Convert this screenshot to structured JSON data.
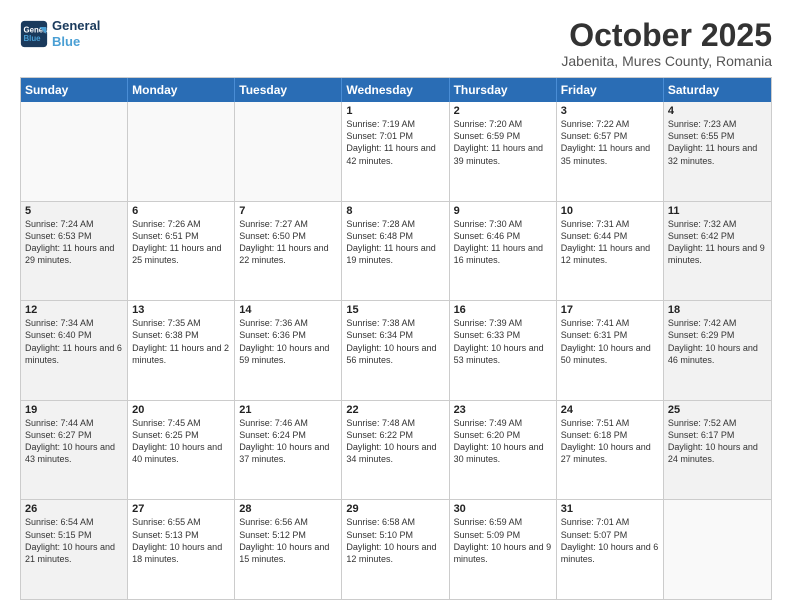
{
  "header": {
    "logo_line1": "General",
    "logo_line2": "Blue",
    "title": "October 2025",
    "subtitle": "Jabenita, Mures County, Romania"
  },
  "weekdays": [
    "Sunday",
    "Monday",
    "Tuesday",
    "Wednesday",
    "Thursday",
    "Friday",
    "Saturday"
  ],
  "weeks": [
    [
      {
        "day": "",
        "text": "",
        "shaded": false,
        "empty": true
      },
      {
        "day": "",
        "text": "",
        "shaded": false,
        "empty": true
      },
      {
        "day": "",
        "text": "",
        "shaded": false,
        "empty": true
      },
      {
        "day": "1",
        "text": "Sunrise: 7:19 AM\nSunset: 7:01 PM\nDaylight: 11 hours and 42 minutes.",
        "shaded": false
      },
      {
        "day": "2",
        "text": "Sunrise: 7:20 AM\nSunset: 6:59 PM\nDaylight: 11 hours and 39 minutes.",
        "shaded": false
      },
      {
        "day": "3",
        "text": "Sunrise: 7:22 AM\nSunset: 6:57 PM\nDaylight: 11 hours and 35 minutes.",
        "shaded": false
      },
      {
        "day": "4",
        "text": "Sunrise: 7:23 AM\nSunset: 6:55 PM\nDaylight: 11 hours and 32 minutes.",
        "shaded": true
      }
    ],
    [
      {
        "day": "5",
        "text": "Sunrise: 7:24 AM\nSunset: 6:53 PM\nDaylight: 11 hours and 29 minutes.",
        "shaded": true
      },
      {
        "day": "6",
        "text": "Sunrise: 7:26 AM\nSunset: 6:51 PM\nDaylight: 11 hours and 25 minutes.",
        "shaded": false
      },
      {
        "day": "7",
        "text": "Sunrise: 7:27 AM\nSunset: 6:50 PM\nDaylight: 11 hours and 22 minutes.",
        "shaded": false
      },
      {
        "day": "8",
        "text": "Sunrise: 7:28 AM\nSunset: 6:48 PM\nDaylight: 11 hours and 19 minutes.",
        "shaded": false
      },
      {
        "day": "9",
        "text": "Sunrise: 7:30 AM\nSunset: 6:46 PM\nDaylight: 11 hours and 16 minutes.",
        "shaded": false
      },
      {
        "day": "10",
        "text": "Sunrise: 7:31 AM\nSunset: 6:44 PM\nDaylight: 11 hours and 12 minutes.",
        "shaded": false
      },
      {
        "day": "11",
        "text": "Sunrise: 7:32 AM\nSunset: 6:42 PM\nDaylight: 11 hours and 9 minutes.",
        "shaded": true
      }
    ],
    [
      {
        "day": "12",
        "text": "Sunrise: 7:34 AM\nSunset: 6:40 PM\nDaylight: 11 hours and 6 minutes.",
        "shaded": true
      },
      {
        "day": "13",
        "text": "Sunrise: 7:35 AM\nSunset: 6:38 PM\nDaylight: 11 hours and 2 minutes.",
        "shaded": false
      },
      {
        "day": "14",
        "text": "Sunrise: 7:36 AM\nSunset: 6:36 PM\nDaylight: 10 hours and 59 minutes.",
        "shaded": false
      },
      {
        "day": "15",
        "text": "Sunrise: 7:38 AM\nSunset: 6:34 PM\nDaylight: 10 hours and 56 minutes.",
        "shaded": false
      },
      {
        "day": "16",
        "text": "Sunrise: 7:39 AM\nSunset: 6:33 PM\nDaylight: 10 hours and 53 minutes.",
        "shaded": false
      },
      {
        "day": "17",
        "text": "Sunrise: 7:41 AM\nSunset: 6:31 PM\nDaylight: 10 hours and 50 minutes.",
        "shaded": false
      },
      {
        "day": "18",
        "text": "Sunrise: 7:42 AM\nSunset: 6:29 PM\nDaylight: 10 hours and 46 minutes.",
        "shaded": true
      }
    ],
    [
      {
        "day": "19",
        "text": "Sunrise: 7:44 AM\nSunset: 6:27 PM\nDaylight: 10 hours and 43 minutes.",
        "shaded": true
      },
      {
        "day": "20",
        "text": "Sunrise: 7:45 AM\nSunset: 6:25 PM\nDaylight: 10 hours and 40 minutes.",
        "shaded": false
      },
      {
        "day": "21",
        "text": "Sunrise: 7:46 AM\nSunset: 6:24 PM\nDaylight: 10 hours and 37 minutes.",
        "shaded": false
      },
      {
        "day": "22",
        "text": "Sunrise: 7:48 AM\nSunset: 6:22 PM\nDaylight: 10 hours and 34 minutes.",
        "shaded": false
      },
      {
        "day": "23",
        "text": "Sunrise: 7:49 AM\nSunset: 6:20 PM\nDaylight: 10 hours and 30 minutes.",
        "shaded": false
      },
      {
        "day": "24",
        "text": "Sunrise: 7:51 AM\nSunset: 6:18 PM\nDaylight: 10 hours and 27 minutes.",
        "shaded": false
      },
      {
        "day": "25",
        "text": "Sunrise: 7:52 AM\nSunset: 6:17 PM\nDaylight: 10 hours and 24 minutes.",
        "shaded": true
      }
    ],
    [
      {
        "day": "26",
        "text": "Sunrise: 6:54 AM\nSunset: 5:15 PM\nDaylight: 10 hours and 21 minutes.",
        "shaded": true
      },
      {
        "day": "27",
        "text": "Sunrise: 6:55 AM\nSunset: 5:13 PM\nDaylight: 10 hours and 18 minutes.",
        "shaded": false
      },
      {
        "day": "28",
        "text": "Sunrise: 6:56 AM\nSunset: 5:12 PM\nDaylight: 10 hours and 15 minutes.",
        "shaded": false
      },
      {
        "day": "29",
        "text": "Sunrise: 6:58 AM\nSunset: 5:10 PM\nDaylight: 10 hours and 12 minutes.",
        "shaded": false
      },
      {
        "day": "30",
        "text": "Sunrise: 6:59 AM\nSunset: 5:09 PM\nDaylight: 10 hours and 9 minutes.",
        "shaded": false
      },
      {
        "day": "31",
        "text": "Sunrise: 7:01 AM\nSunset: 5:07 PM\nDaylight: 10 hours and 6 minutes.",
        "shaded": false
      },
      {
        "day": "",
        "text": "",
        "shaded": true,
        "empty": true
      }
    ]
  ]
}
